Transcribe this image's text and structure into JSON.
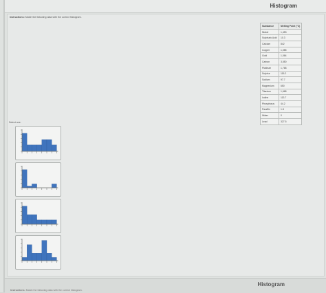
{
  "header": {
    "title": "Histogram"
  },
  "instructions": {
    "label": "Instructions:",
    "text": "Match the following data with the correct histogram."
  },
  "table": {
    "headers": [
      "Substance",
      "Melting Point (°C)"
    ],
    "rows": [
      [
        "Nickel",
        "1,453"
      ],
      [
        "Sulphuric Acid",
        "10.3"
      ],
      [
        "Calcium",
        "842"
      ],
      [
        "Copper",
        "1,085"
      ],
      [
        "Gold",
        "1,064"
      ],
      [
        "Carbon",
        "3,550"
      ],
      [
        "Platinum",
        "1,768"
      ],
      [
        "Sulphur",
        "115.2"
      ],
      [
        "Sodium",
        "97.7"
      ],
      [
        "Magnesium",
        "650"
      ],
      [
        "Titanium",
        "1,668"
      ],
      [
        "Iodine",
        "113.7"
      ],
      [
        "Phosphorus",
        "44.2"
      ],
      [
        "Paraffin",
        "1.8"
      ],
      [
        "Water",
        "0"
      ],
      [
        "Lead",
        "327.5"
      ]
    ]
  },
  "options": {
    "label": "Select one:"
  },
  "histograms": [
    {
      "values": [
        0.85,
        0.3,
        0.3,
        0.3,
        0.55,
        0.55,
        0.3
      ]
    },
    {
      "values": [
        0.85,
        0.08,
        0.18,
        0.0,
        0.0,
        0.0,
        0.18
      ]
    },
    {
      "values": [
        0.85,
        0.45,
        0.45,
        0.2,
        0.2,
        0.2,
        0.2
      ]
    },
    {
      "values": [
        0.15,
        0.75,
        0.35,
        0.35,
        0.95,
        0.35,
        0.15
      ]
    }
  ],
  "footer": {
    "title": "Histogram",
    "label": "Instructions:",
    "text": "Match the following data with the correct histogram."
  },
  "colors": {
    "bar": "#3f74bd",
    "axis": "#6a6e6c"
  }
}
